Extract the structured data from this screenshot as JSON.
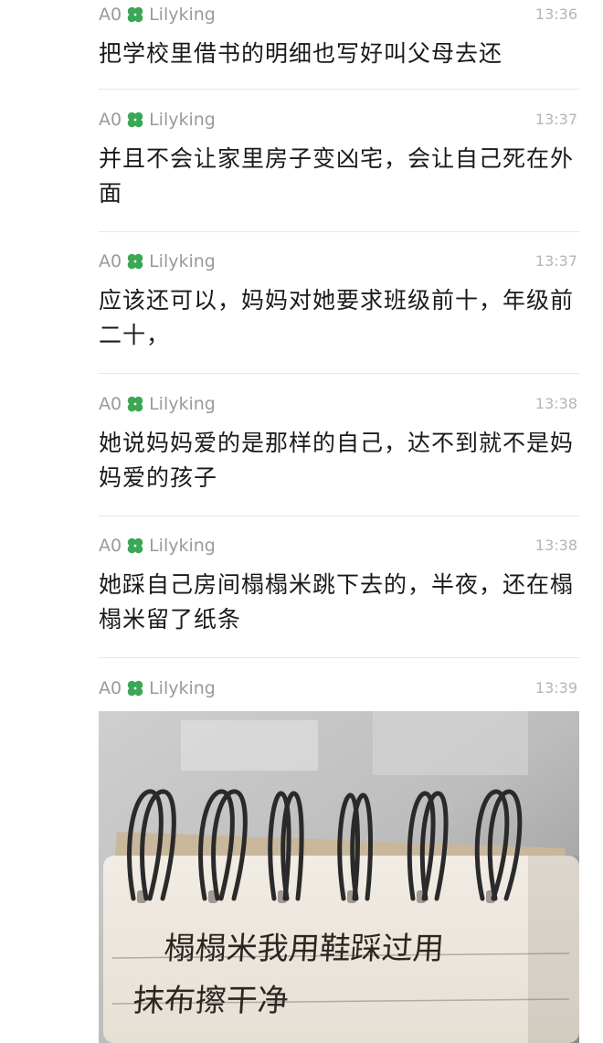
{
  "messages": [
    {
      "sender": "A0",
      "nickname": "Lilyking",
      "time": "13:36",
      "text": "把学校里借书的明细也写好叫父母去还"
    },
    {
      "sender": "A0",
      "nickname": "Lilyking",
      "time": "13:37",
      "text": "并且不会让家里房子变凶宅，会让自己死在外面"
    },
    {
      "sender": "A0",
      "nickname": "Lilyking",
      "time": "13:37",
      "text": "应该还可以，妈妈对她要求班级前十，年级前二十，"
    },
    {
      "sender": "A0",
      "nickname": "Lilyking",
      "time": "13:38",
      "text": "她说妈妈爱的是那样的自己，达不到就不是妈妈爱的孩子"
    },
    {
      "sender": "A0",
      "nickname": "Lilyking",
      "time": "13:38",
      "text": "她踩自己房间榻榻米跳下去的，半夜，还在榻榻米留了纸条"
    },
    {
      "sender": "A0",
      "nickname": "Lilyking",
      "time": "13:39",
      "text": ""
    }
  ],
  "note": {
    "line1": "榻榻米我用鞋踩过用",
    "line2": "抹布擦干净"
  },
  "colors": {
    "clover": "#3aa855",
    "meta_text": "#9a9a9a",
    "time_text": "#b5b5b5",
    "divider": "#e6e6e6"
  },
  "icons": {
    "clover": "four-leaf-clover-icon"
  }
}
